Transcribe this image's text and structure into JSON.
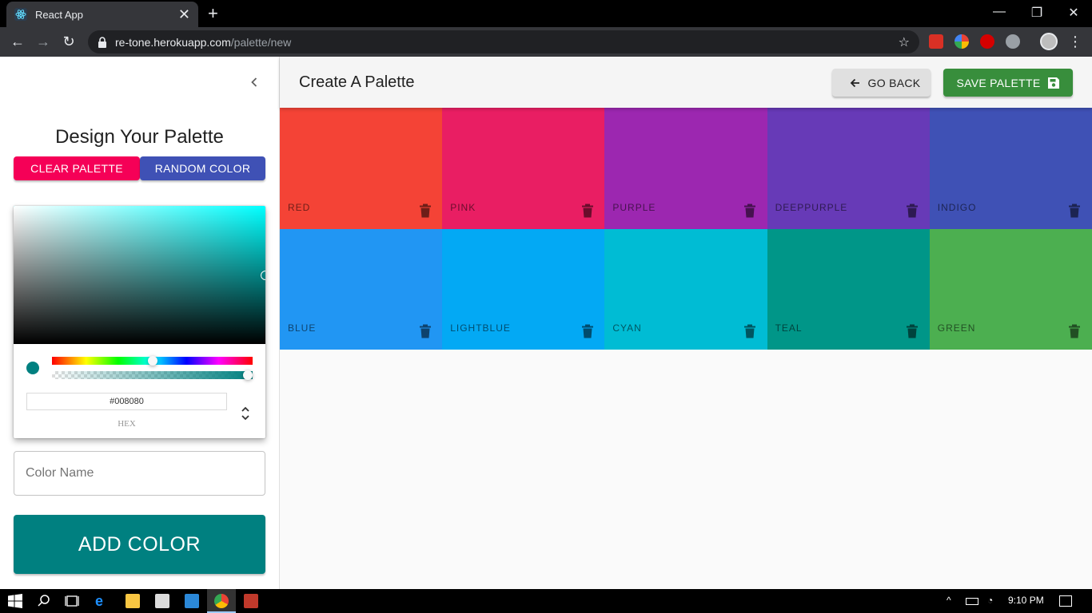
{
  "browser": {
    "tab_title": "React App",
    "close_tab": "✕",
    "new_tab": "+",
    "url_host": "re-tone.herokuapp.com",
    "url_path": "/palette/new"
  },
  "drawer": {
    "title": "Design Your Palette",
    "clear_label": "CLEAR PALETTE",
    "random_label": "RANDOM COLOR",
    "picker": {
      "hex_value": "#008080",
      "hex_label": "HEX",
      "hue_fraction": 0.5,
      "alpha_fraction": 1.0
    },
    "name_placeholder": "Color Name",
    "add_label": "ADD COLOR"
  },
  "appbar": {
    "title": "Create A Palette",
    "back_label": "GO BACK",
    "save_label": "SAVE PALETTE"
  },
  "colors": [
    {
      "name": "red",
      "hex": "#f44336"
    },
    {
      "name": "pink",
      "hex": "#e91e63"
    },
    {
      "name": "purple",
      "hex": "#9c27b0"
    },
    {
      "name": "deeppurple",
      "hex": "#673ab7"
    },
    {
      "name": "indigo",
      "hex": "#3f51b5"
    },
    {
      "name": "blue",
      "hex": "#2196f3"
    },
    {
      "name": "lightblue",
      "hex": "#03a9f4"
    },
    {
      "name": "cyan",
      "hex": "#00bcd4"
    },
    {
      "name": "teal",
      "hex": "#009688"
    },
    {
      "name": "green",
      "hex": "#4caf50"
    }
  ],
  "taskbar": {
    "time": "9:10 PM"
  }
}
